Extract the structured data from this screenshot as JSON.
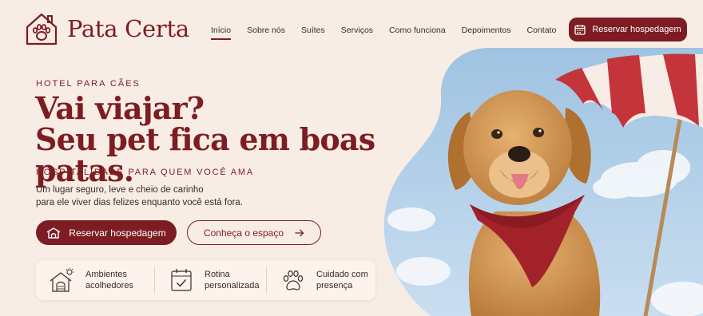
{
  "brand": {
    "name": "Pata Certa"
  },
  "nav": {
    "items": [
      {
        "label": "Início",
        "active": true
      },
      {
        "label": "Sobre nós",
        "active": false
      },
      {
        "label": "Suítes",
        "active": false
      },
      {
        "label": "Serviços",
        "active": false
      },
      {
        "label": "Como funciona",
        "active": false
      },
      {
        "label": "Depoimentos",
        "active": false
      },
      {
        "label": "Contato",
        "active": false
      }
    ],
    "cta_label": "Reservar hospedagem"
  },
  "hero": {
    "kicker": "HOTEL PARA CÃES",
    "headline_line1": "Vai viajar?",
    "headline_line2": "Seu pet fica em boas patas.",
    "subtitle": "HOSPITALIDADE PARA QUEM VOCÊ AMA",
    "description_line1": "Um lugar seguro, leve e cheio de carinho",
    "description_line2": "para ele viver dias felizes enquanto você está fora.",
    "primary_button": "Reservar hospedagem",
    "secondary_button": "Conheça o espaço"
  },
  "features": [
    {
      "icon": "house-sun-icon",
      "line1": "Ambientes",
      "line2": "acolhedores"
    },
    {
      "icon": "calendar-check-icon",
      "line1": "Rotina",
      "line2": "personalizada"
    },
    {
      "icon": "paw-icon",
      "line1": "Cuidado com",
      "line2": "presença"
    }
  ],
  "colors": {
    "brand": "#7d1c22",
    "background": "#f8ede4",
    "sky": "#a9cbe6"
  }
}
